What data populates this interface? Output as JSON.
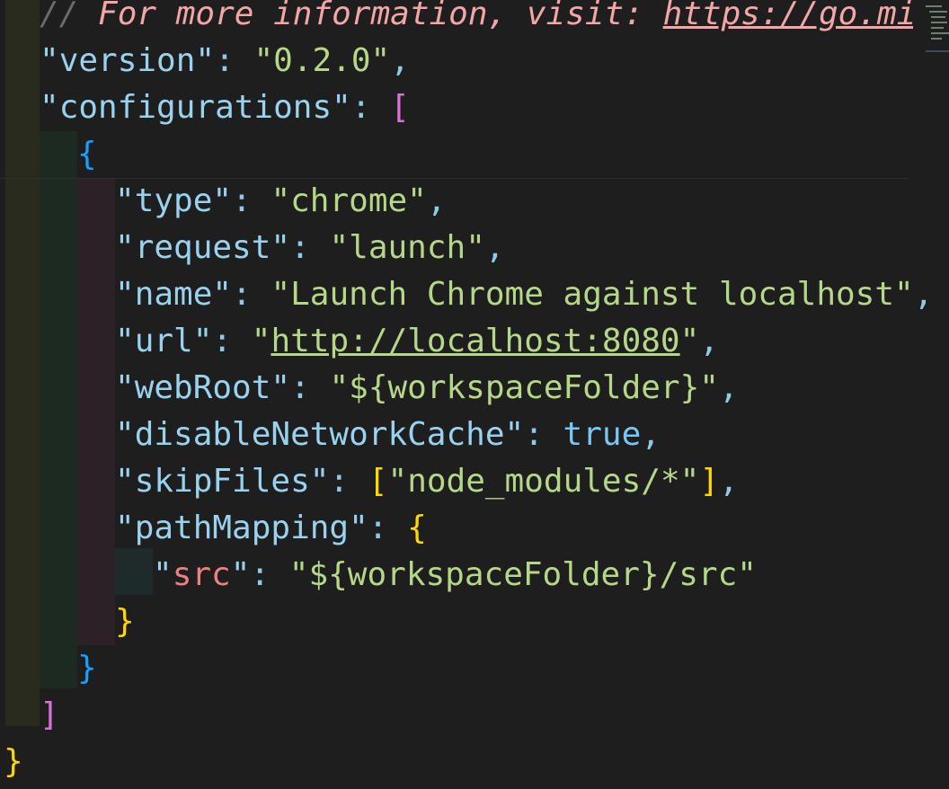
{
  "editor": {
    "lines": [
      {
        "comment_prefix": "// ",
        "comment_text": "For more information, visit: ",
        "comment_link": "https://go.mic"
      },
      {
        "key": "version",
        "value": "0.2.0"
      },
      {
        "key": "configurations",
        "open": "["
      },
      {
        "open": "{"
      },
      {
        "key": "type",
        "value": "chrome"
      },
      {
        "key": "request",
        "value": "launch"
      },
      {
        "key": "name",
        "value": "Launch Chrome against localhost"
      },
      {
        "key": "url",
        "value": "http://localhost:8080"
      },
      {
        "key": "webRoot",
        "value": "${workspaceFolder}"
      },
      {
        "key": "disableNetworkCache",
        "value": "true"
      },
      {
        "key": "skipFiles",
        "value": "node_modules/*"
      },
      {
        "key": "pathMapping",
        "open": "{"
      },
      {
        "key": "src",
        "value": "${workspaceFolder}/src"
      },
      {
        "close": "}"
      },
      {
        "close": "}"
      },
      {
        "close": "]"
      },
      {
        "close": "}"
      }
    ]
  },
  "colors": {
    "background": "#1e1e1e",
    "string": "#b4d788",
    "key": "#98d2ee",
    "comment": "#f4a6a6",
    "bracket_gold": "#ffd700",
    "bracket_purple": "#da70d6",
    "bracket_blue": "#179fff"
  }
}
